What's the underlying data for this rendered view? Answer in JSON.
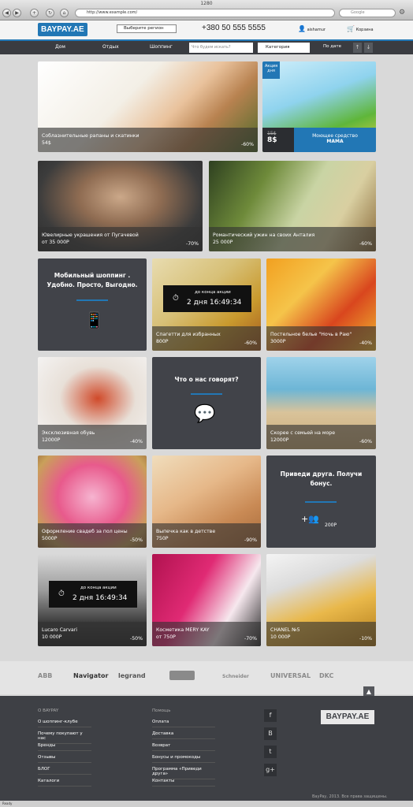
{
  "browser": {
    "title": "1280",
    "url": "http://www.example.com/",
    "search_placeholder": "Google"
  },
  "header": {
    "logo": "BAYPAY.AE",
    "region": "Выберите регион",
    "phone": "+380 50 555 5555",
    "user": "aishamur",
    "cart": "Корзина"
  },
  "menu": {
    "items": [
      "Дом",
      "Отдых",
      "Шоппинг"
    ],
    "search_placeholder": "Что будем искать?",
    "category": "Категория",
    "sort": "По дате"
  },
  "tiles": [
    {
      "title": "Соблазнительные рапаны и скатинки",
      "price": "54$",
      "discount": "-60%"
    },
    {
      "badge": "Акция дня",
      "old_price": "15$",
      "new_price": "8$",
      "title": "Моющее средство",
      "subtitle": "МАМА"
    },
    {
      "title": "Ювелирные украшения от Пугачевой",
      "price": "от 35 000Р",
      "discount": "-70%"
    },
    {
      "title": "Романтический ужин на своих Анталия",
      "price": "25 000Р",
      "discount": "-60%"
    },
    {
      "promo": "Мобильный шоппинг . Удобно. Просто, Выгодно."
    },
    {
      "timer_label": "до конца акции",
      "timer": "2 дня 16:49:34",
      "title": "Спагетти для избранных",
      "price": "800Р",
      "discount": "-60%"
    },
    {
      "title": "Постельное белье \"Ночь в Раю\"",
      "price": "3000Р",
      "discount": "-40%"
    },
    {
      "title": "Эксклюзивная обувь",
      "price": "12000Р",
      "discount": "-40%"
    },
    {
      "promo": "Что о нас говорят?"
    },
    {
      "title": "Скорее с семьей на море",
      "price": "12000Р",
      "discount": "-60%"
    },
    {
      "title": "Оформление свадеб за пол цены",
      "price": "5000Р",
      "discount": "-50%"
    },
    {
      "title": "Выпечка как в детстве",
      "price": "750Р",
      "discount": "-90%"
    },
    {
      "promo": "Приведи друга. Получи бонус.",
      "bonus": "200Р"
    },
    {
      "timer_label": "до конца акции",
      "timer": "2 дня 16:49:34",
      "title": "Lucaro Carvari",
      "price": "10 000Р",
      "discount": "-50%"
    },
    {
      "title": "Косметика MERY KAY",
      "price": "от 750Р",
      "discount": "-70%"
    },
    {
      "title": "CHANEL №5",
      "price": "10 000Р",
      "discount": "-10%"
    }
  ],
  "brands": [
    "ABB",
    "Navigator",
    "legrand",
    "",
    "Schneider",
    "UNIVERSAL",
    "DKC"
  ],
  "footer": {
    "col1_head": "О BAYPAY",
    "col1": [
      "О шоппинг-клубе",
      "Почему покупают у нас",
      "Бренды",
      "Отзывы",
      "БЛОГ",
      "Каталоги"
    ],
    "col2_head": "Помощь",
    "col2": [
      "Оплата",
      "Доставка",
      "Возврат",
      "Бонусы и промокоды",
      "Программа «Приведи друга»",
      "Контакты"
    ],
    "social": [
      "f",
      "B",
      "t",
      "g+"
    ],
    "logo": "BAYPAY.AE",
    "copyright": "BayPay, 2013. Все права защищены."
  },
  "status": "Ready"
}
